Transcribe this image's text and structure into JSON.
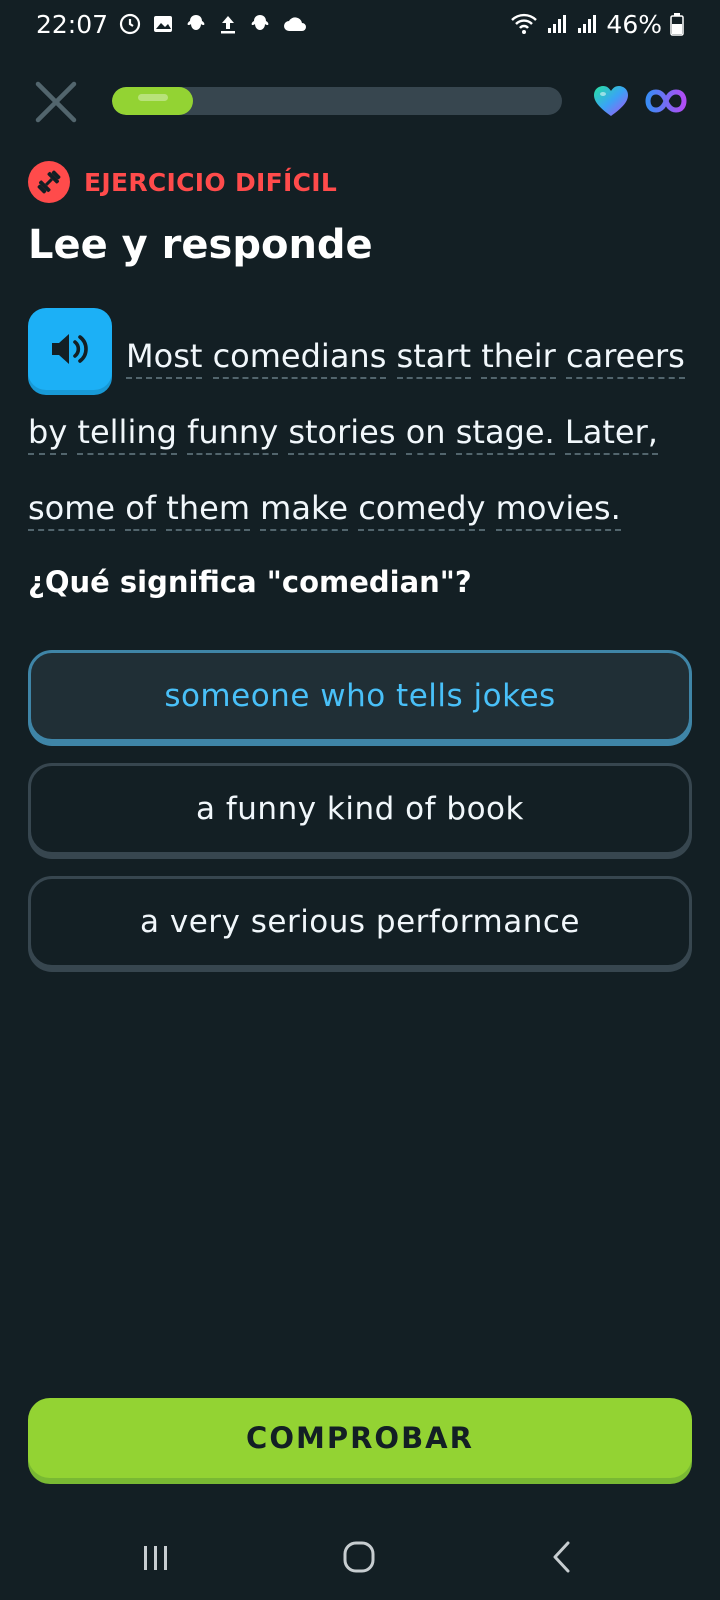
{
  "status_bar": {
    "time": "22:07",
    "battery": "46%"
  },
  "progress": {
    "fraction": 0.18
  },
  "badge": {
    "label": "EJERCICIO DIFÍCIL"
  },
  "title": "Lee y responde",
  "passage": {
    "lines": [
      [
        "Most",
        "comedians",
        "start",
        "their",
        "careers"
      ],
      [
        "by",
        "telling",
        "funny",
        "stories",
        "on",
        "stage.",
        "Later,"
      ],
      [
        "some",
        "of",
        "them",
        "make",
        "comedy",
        "movies."
      ]
    ]
  },
  "question": "¿Qué significa \"comedian\"?",
  "options": [
    {
      "label": "someone who tells jokes",
      "selected": true
    },
    {
      "label": "a funny kind of book",
      "selected": false
    },
    {
      "label": "a very serious performance",
      "selected": false
    }
  ],
  "check_button": {
    "label": "COMPROBAR"
  },
  "colors": {
    "background": "#131f24",
    "accent_green": "#93d333",
    "accent_blue": "#1cb0f6",
    "hard_red": "#ff4b4b",
    "selected_text": "#49c0f8"
  },
  "icons": [
    "close-icon",
    "heart-icon",
    "infinity-icon",
    "dumbbell-icon",
    "speaker-icon",
    "recents-icon",
    "home-icon",
    "back-icon"
  ]
}
